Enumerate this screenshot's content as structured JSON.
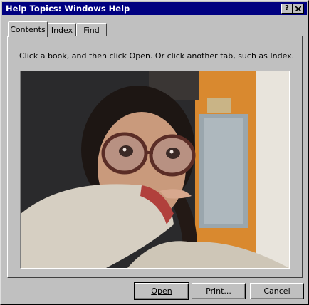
{
  "window": {
    "title": "Help Topics: Windows Help",
    "help_button": "?",
    "close_button": "✕"
  },
  "tabs": [
    {
      "label": "Contents",
      "active": true
    },
    {
      "label": "Index",
      "active": false
    },
    {
      "label": "Find",
      "active": false
    }
  ],
  "contents": {
    "instructions": "Click a book, and then click Open. Or click another tab, such as Index.",
    "photo_icon": "photo-of-person-with-glasses"
  },
  "buttons": {
    "open": "Open",
    "print": "Print...",
    "cancel": "Cancel"
  },
  "colors": {
    "titlebar": "#000080",
    "face": "#c0c0c0"
  }
}
